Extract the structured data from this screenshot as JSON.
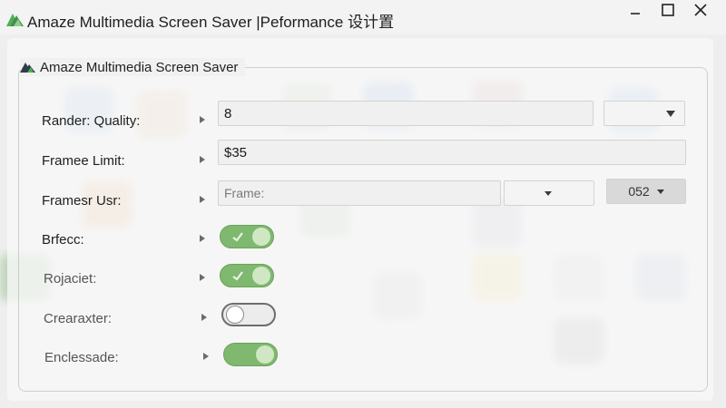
{
  "window": {
    "title": "Amaze Multimedia Screen Saver |Peformance 设计置",
    "controls": [
      "minimize",
      "maximize",
      "close"
    ]
  },
  "group": {
    "title": "Amaze Multimedia Screen Saver",
    "icon": "amaze-logo-icon"
  },
  "settings": {
    "render_quality": {
      "label": "Rander: Quality:",
      "value": "8",
      "dropdown_value": ""
    },
    "frame_limit": {
      "label": "Framee Limit:",
      "value": "$35"
    },
    "frames_usage": {
      "label": "Framesr Usr:",
      "placeholder": "Frame:",
      "dropdown_value": "",
      "secondary_value": "052"
    },
    "toggle1": {
      "label": "Brfecc:",
      "state": "on"
    },
    "toggle2": {
      "label": "Rojaciet:",
      "state": "on"
    },
    "toggle3": {
      "label": "Crearaxter:",
      "state": "off"
    },
    "toggle4": {
      "label": "Enclessade:",
      "state": "on"
    }
  },
  "colors": {
    "toggle_on": "#7fb86f",
    "toggle_off_border": "#6d6d6d",
    "logo_green": "#4caf50",
    "logo_dark": "#2f3a4a"
  }
}
